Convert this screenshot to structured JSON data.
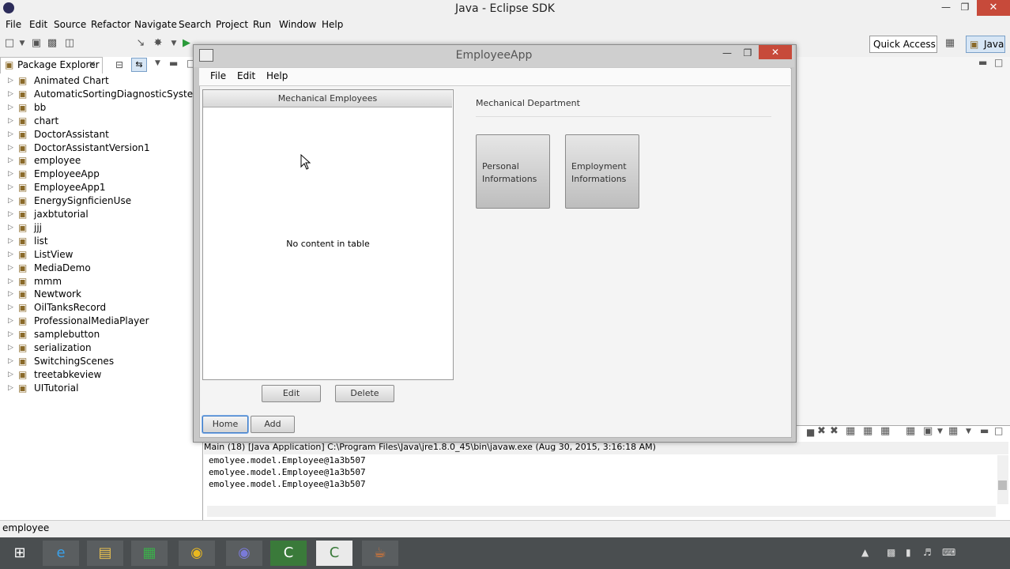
{
  "eclipse": {
    "title": "Java - Eclipse SDK",
    "menu": [
      "File",
      "Edit",
      "Source",
      "Refactor",
      "Navigate",
      "Search",
      "Project",
      "Run",
      "Window",
      "Help"
    ],
    "quick_access": "Quick Access",
    "perspective": "Java"
  },
  "package_explorer": {
    "tab_label": "Package Explorer",
    "projects": [
      "Animated Chart",
      "AutomaticSortingDiagnosticSystem",
      "bb",
      "chart",
      "DoctorAssistant",
      "DoctorAssistantVersion1",
      "employee",
      "EmployeeApp",
      "EmployeeApp1",
      "EnergySignficienUse",
      "jaxbtutorial",
      "jjj",
      "list",
      "ListView",
      "MediaDemo",
      "mmm",
      "Newtwork",
      "OilTanksRecord",
      "ProfessionalMediaPlayer",
      "samplebutton",
      "serialization",
      "SwitchingScenes",
      "treetabkeview",
      "UITutorial"
    ]
  },
  "console": {
    "header": "Main (18) [Java Application] C:\\Program Files\\Java\\jre1.8.0_45\\bin\\javaw.exe (Aug 30, 2015, 3:16:18 AM)",
    "lines": [
      "emolyee.model.Employee@1a3b507",
      "emolyee.model.Employee@1a3b507",
      "emolyee.model.Employee@1a3b507"
    ]
  },
  "status_bar": {
    "text": "employee"
  },
  "app": {
    "title": "EmployeeApp",
    "menu": [
      "File",
      "Edit",
      "Help"
    ],
    "table": {
      "header": "Mechanical Employees",
      "empty_text": "No content in table"
    },
    "edit_button": "Edit",
    "delete_button": "Delete",
    "home_button": "Home",
    "add_button": "Add",
    "department_label": "Mechanical Department",
    "tiles": [
      {
        "line1": "Personal",
        "line2": "Informations"
      },
      {
        "line1": "Employment",
        "line2": "Informations"
      }
    ]
  }
}
